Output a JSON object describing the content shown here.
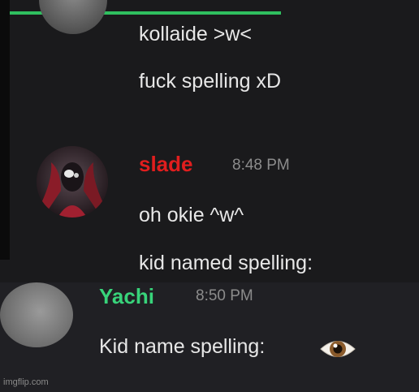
{
  "messages": {
    "line1": "kollaide >w<",
    "line2": "fuck spelling xD",
    "slade": {
      "username": "slade",
      "timestamp": "8:48 PM",
      "line1": "oh okie ^w^",
      "line2": "kid named spelling:"
    },
    "yachi": {
      "username": "Yachi",
      "timestamp": "8:50 PM",
      "text": "Kid name spelling:"
    }
  },
  "watermark": "imgflip.com",
  "colors": {
    "slade_name": "#e11e1e",
    "yachi_name": "#38d37a",
    "green_bar": "#2fbf5f"
  },
  "icons": {
    "eye": "eye-emoji-icon"
  }
}
